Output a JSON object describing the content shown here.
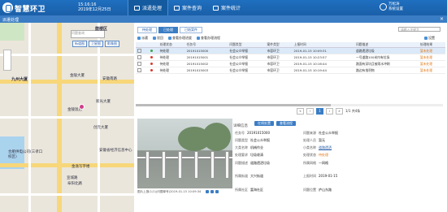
{
  "app": {
    "title": "智慧环卫",
    "time": "15:16:16",
    "date": "2019年12月25日",
    "user_name": "万松涛",
    "user_action": "系统设置"
  },
  "nav": [
    {
      "label": "派遣处理",
      "active": true
    },
    {
      "label": "案件查询",
      "active": false
    },
    {
      "label": "案件统计",
      "active": false
    }
  ],
  "window": {
    "title": "派遣处理",
    "close": "×"
  },
  "map": {
    "search_placeholder": "问题查询",
    "buttons": [
      "街道图",
      "卫星图",
      "影像图"
    ],
    "labels": [
      "鼓楼区",
      "九州大厦",
      "金陵大厦",
      "创元大厦",
      "安徽南路",
      "新光大厦",
      "金陵饭店",
      "合肥供电公司(三孝口校区)",
      "金逸写字楼",
      "安徽省经济信息中心",
      "宣城路",
      "阜阳北路"
    ]
  },
  "panel": {
    "tabs": [
      {
        "label": "待处理",
        "active": false
      },
      {
        "label": "已处理",
        "active": true
      },
      {
        "label": "已结案件",
        "active": false
      }
    ],
    "search_placeholder": "请输入关键字",
    "toolbar": [
      "派遣",
      "驳回",
      "查看办理进度",
      "查看办理流程"
    ],
    "settings": "设置",
    "columns": [
      "",
      "",
      "处理状态",
      "任务号",
      "问题类型",
      "案件类型",
      "上报时间",
      "问题描述",
      "处理结果"
    ],
    "rows": [
      {
        "status_color": "green",
        "status": "待处理",
        "task": "20191015000",
        "type": "社会公众举报",
        "category": "市容环卫",
        "time": "2019-01-15 10:09:31",
        "desc": "道路遗洒垃圾",
        "result": "暂未处理",
        "selected": true
      },
      {
        "status_color": "red",
        "status": "待处理",
        "task": "20191015001",
        "type": "社会公众举报",
        "category": "市容环卫",
        "time": "2019-01-15 10:23:57",
        "desc": "一号道路100米内有垃圾",
        "result": "暂未处理",
        "selected": false
      },
      {
        "status_color": "red",
        "status": "待处理",
        "task": "20191015002",
        "type": "社会公众举报",
        "category": "市容环卫",
        "time": "2019-01-15 10:16:44",
        "desc": "路面有深坑且被雨水冲刷",
        "result": "暂未处理",
        "selected": false
      },
      {
        "status_color": "red",
        "status": "待处理",
        "task": "20191015003",
        "type": "社会公众举报",
        "category": "市容环卫",
        "time": "2019-01-15 10:19:44",
        "desc": "路边有堆积物",
        "result": "暂未处理",
        "selected": false
      }
    ],
    "pager": {
      "page": "1",
      "summary": "1/1 共4条"
    }
  },
  "detail": {
    "label": "详细信息",
    "buttons": [
      "在线处置",
      "查看流程"
    ],
    "photo_caption": "图片上报(1/1)(问题单号)2019-01-15 10:09:34",
    "fields_left": [
      {
        "k": "任务号",
        "v": "20191015000"
      },
      {
        "k": "问题类型",
        "v": "社会公众举报"
      },
      {
        "k": "大类名称",
        "v": "机械作业"
      },
      {
        "k": "处理要求",
        "v": "垃圾收清"
      },
      {
        "k": "问题描述",
        "v": "道路遗洒垃圾"
      },
      {
        "k": "所属街道",
        "v": "大兴街道"
      },
      {
        "k": "所属社区",
        "v": "富海社区"
      }
    ],
    "fields_right": [
      {
        "k": "问题来源",
        "v": "社会公众举报",
        "style": ""
      },
      {
        "k": "处理人员",
        "v": "暂无",
        "style": ""
      },
      {
        "k": "小类名称",
        "v": "道路遗洒",
        "style": "blue"
      },
      {
        "k": "处理状态",
        "v": "待处理",
        "style": "orange"
      },
      {
        "k": "所属网格",
        "v": "一网格",
        "style": ""
      },
      {
        "k": "上报时间",
        "v": "2019-01-15",
        "style": ""
      },
      {
        "k": "问题位置",
        "v": "庐山东路",
        "style": ""
      }
    ]
  }
}
